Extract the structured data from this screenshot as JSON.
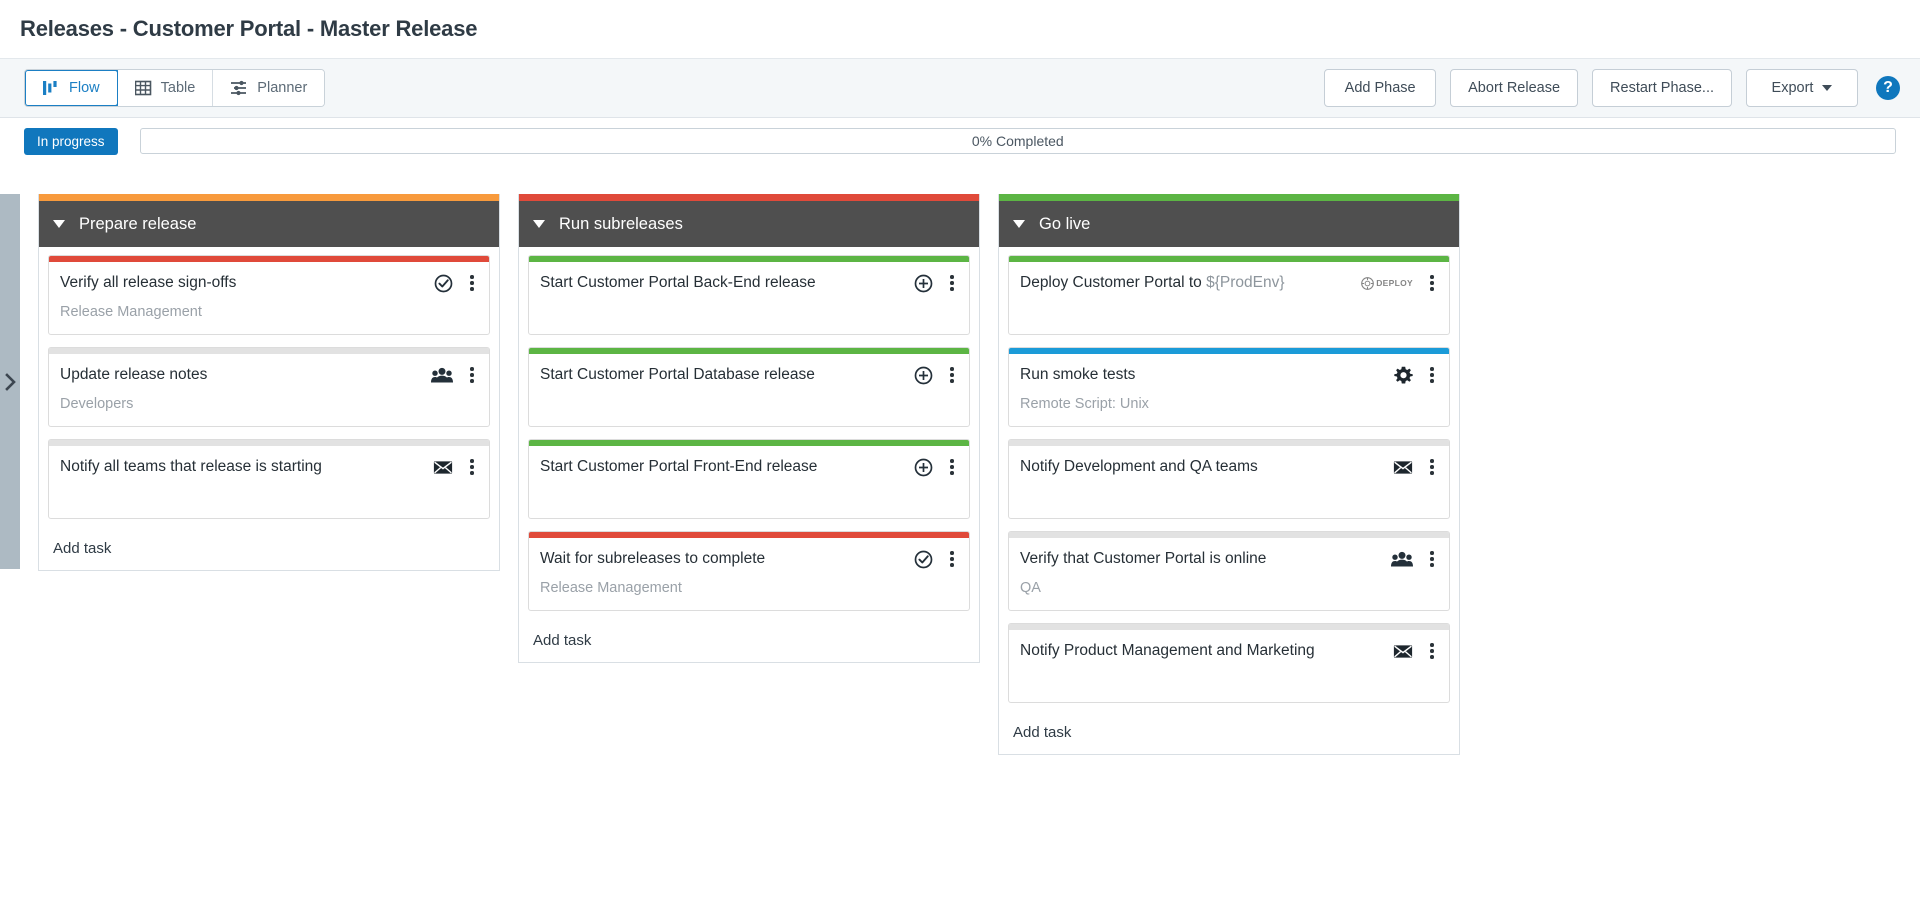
{
  "header": {
    "title": "Releases - Customer Portal - Master Release"
  },
  "toolbar": {
    "tabs": [
      {
        "label": "Flow",
        "icon": "flow-icon",
        "active": true
      },
      {
        "label": "Table",
        "icon": "table-icon",
        "active": false
      },
      {
        "label": "Planner",
        "icon": "planner-icon",
        "active": false
      }
    ],
    "buttons": [
      {
        "label": "Add Phase"
      },
      {
        "label": "Abort Release"
      },
      {
        "label": "Restart Phase..."
      },
      {
        "label": "Export",
        "caret": true
      }
    ],
    "help_icon": "?"
  },
  "status": {
    "badge": "In progress",
    "badge_color": "#1077bd",
    "progress_label": "0% Completed",
    "progress_percent": 0
  },
  "sidebar": {
    "toggle_icon": "chevron-right-icon"
  },
  "colors": {
    "orange": "#f89a3c",
    "red": "#e04a3a",
    "green": "#5cb544",
    "blue": "#1b9bd8",
    "grey": "#e2e2e2",
    "header_bg": "#4f4f4f"
  },
  "phases": [
    {
      "name": "Prepare release",
      "top_color": "#f89a3c",
      "add_task_label": "Add task",
      "tasks": [
        {
          "title": "Verify all release sign-offs",
          "subtitle": "Release Management",
          "top_color": "#e04a3a",
          "icon": "check-circle-icon"
        },
        {
          "title": "Update release notes",
          "subtitle": "Developers",
          "top_color": "#e2e2e2",
          "icon": "users-icon"
        },
        {
          "title": "Notify all teams that release is starting",
          "subtitle": "",
          "top_color": "#e2e2e2",
          "icon": "envelope-icon"
        }
      ]
    },
    {
      "name": "Run subreleases",
      "top_color": "#e04a3a",
      "add_task_label": "Add task",
      "tasks": [
        {
          "title": "Start Customer Portal Back-End release",
          "subtitle": "",
          "top_color": "#5cb544",
          "icon": "plus-circle-icon"
        },
        {
          "title": "Start Customer Portal Database release",
          "subtitle": "",
          "top_color": "#5cb544",
          "icon": "plus-circle-icon"
        },
        {
          "title": "Start Customer Portal Front-End release",
          "subtitle": "",
          "top_color": "#5cb544",
          "icon": "plus-circle-icon"
        },
        {
          "title": "Wait for subreleases to complete",
          "subtitle": "Release Management",
          "top_color": "#e04a3a",
          "icon": "check-circle-icon"
        }
      ]
    },
    {
      "name": "Go live",
      "top_color": "#5cb544",
      "add_task_label": "Add task",
      "tasks": [
        {
          "title": "Deploy Customer Portal to ",
          "title_var": "${ProdEnv}",
          "subtitle": "",
          "top_color": "#5cb544",
          "icon": "deploy-logo-icon",
          "icon_text": "DEPLOY"
        },
        {
          "title": "Run smoke tests",
          "subtitle": "Remote Script: Unix",
          "top_color": "#1b9bd8",
          "icon": "gear-icon"
        },
        {
          "title": "Notify Development and QA teams",
          "subtitle": "",
          "top_color": "#e2e2e2",
          "icon": "envelope-icon"
        },
        {
          "title": "Verify that Customer Portal is online",
          "subtitle": "QA",
          "top_color": "#e2e2e2",
          "icon": "users-icon"
        },
        {
          "title": "Notify Product Management and Marketing",
          "subtitle": "",
          "top_color": "#e2e2e2",
          "icon": "envelope-icon"
        }
      ]
    }
  ]
}
